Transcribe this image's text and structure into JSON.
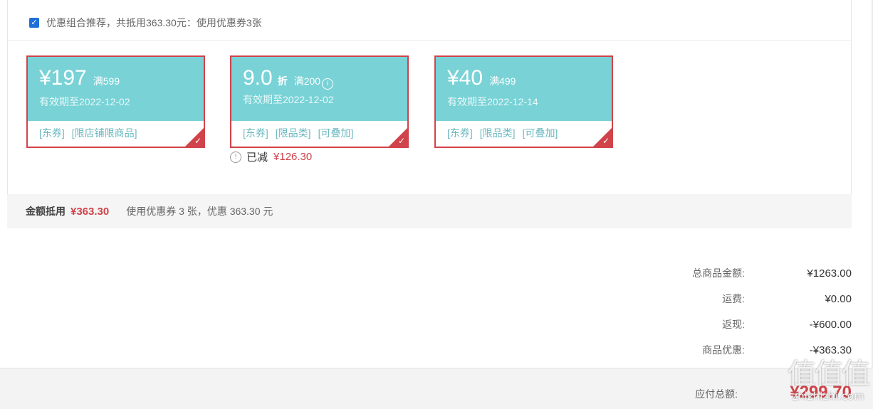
{
  "recommendation": {
    "checked": true,
    "label": "优惠组合推荐，共抵用363.30元：使用优惠券3张"
  },
  "coupons": [
    {
      "amount": "¥197",
      "condition": "满599",
      "valid": "有效期至2022-12-02",
      "tags": [
        "[东券]",
        "[限店铺限商品]"
      ]
    },
    {
      "amount": "9.0",
      "unit": "折",
      "condition": "满200",
      "valid": "有效期至2022-12-02",
      "tags": [
        "[东券]",
        "[限品类]",
        "[可叠加]"
      ]
    },
    {
      "amount": "¥40",
      "condition": "满499",
      "valid": "有效期至2022-12-14",
      "tags": [
        "[东券]",
        "[限品类]",
        "[可叠加]"
      ]
    }
  ],
  "reduced": {
    "label": "已减",
    "value": "¥126.30"
  },
  "summary": {
    "label": "金额抵用",
    "amount": "¥363.30",
    "desc": "使用优惠券 3 张，优惠 363.30 元"
  },
  "totals": [
    {
      "label": "总商品金额:",
      "value": "¥1263.00"
    },
    {
      "label": "运费:",
      "value": "¥0.00"
    },
    {
      "label": "返现:",
      "value": "-¥600.00"
    },
    {
      "label": "商品优惠:",
      "value": "-¥363.30"
    }
  ],
  "payable": {
    "label": "应付总额:",
    "value": "¥299.70"
  },
  "watermark": {
    "glyphs": "值",
    "domain": "zhizhizhi.com"
  },
  "colors": {
    "accent": "#d0434a",
    "coupon_bg": "#78d2d6"
  }
}
